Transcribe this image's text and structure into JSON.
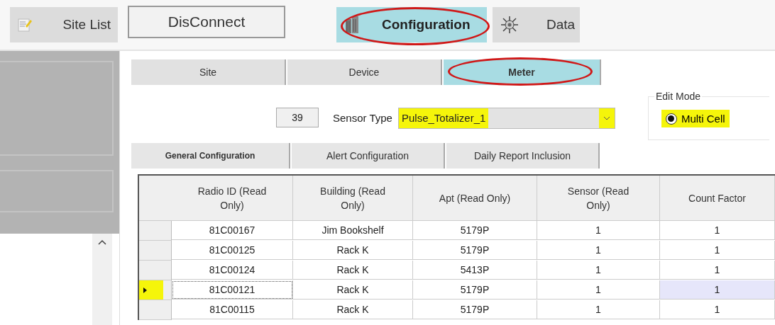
{
  "toolbar": [
    {
      "kind": "sitelist",
      "label": "Site List",
      "selected": false,
      "circled": false
    },
    {
      "kind": "plain",
      "label": "DisConnect",
      "selected": false,
      "circled": false
    },
    {
      "kind": "config",
      "label": "Configuration",
      "selected": true,
      "circled": true
    },
    {
      "kind": "data",
      "label": "Data",
      "selected": false,
      "circled": false
    }
  ],
  "tabs": [
    {
      "label": "Site",
      "selected": false,
      "circled": false
    },
    {
      "label": "Device",
      "selected": false,
      "circled": false
    },
    {
      "label": "Meter",
      "selected": true,
      "circled": true
    }
  ],
  "count": "39",
  "sensor_type": {
    "label": "Sensor Type",
    "value": "Pulse_Totalizer_1",
    "highlighted": true
  },
  "edit_mode": {
    "title": "Edit Mode",
    "option": "Multi Cell",
    "checked": true,
    "highlighted": true
  },
  "subtabs": [
    {
      "label": "General Configuration",
      "selected": true
    },
    {
      "label": "Alert Configuration",
      "selected": false
    },
    {
      "label": "Daily Report Inclusion",
      "selected": false
    }
  ],
  "table": {
    "columns": [
      "Radio ID (Read Only)",
      "Building (Read Only)",
      "Apt (Read Only)",
      "Sensor (Read Only)",
      "Count Factor"
    ],
    "rows": [
      {
        "current": false,
        "marked": false,
        "cells": [
          {
            "text": "81C00167",
            "selected": false
          },
          {
            "text": "Jim Bookshelf",
            "selected": false
          },
          {
            "text": "5179P",
            "selected": false
          },
          {
            "text": "1",
            "selected": false
          },
          {
            "text": "1",
            "selected": false
          }
        ]
      },
      {
        "current": false,
        "marked": false,
        "cells": [
          {
            "text": "81C00125",
            "selected": false
          },
          {
            "text": "Rack K",
            "selected": false
          },
          {
            "text": "5179P",
            "selected": false
          },
          {
            "text": "1",
            "selected": false
          },
          {
            "text": "1",
            "selected": false
          }
        ]
      },
      {
        "current": false,
        "marked": false,
        "cells": [
          {
            "text": "81C00124",
            "selected": false
          },
          {
            "text": "Rack K",
            "selected": false
          },
          {
            "text": "5413P",
            "selected": false
          },
          {
            "text": "1",
            "selected": false
          },
          {
            "text": "1",
            "selected": false
          }
        ]
      },
      {
        "current": true,
        "marked": true,
        "cells": [
          {
            "text": "81C00121",
            "selected": false
          },
          {
            "text": "Rack K",
            "selected": false
          },
          {
            "text": "5179P",
            "selected": false
          },
          {
            "text": "1",
            "selected": false
          },
          {
            "text": "1",
            "selected": true
          }
        ]
      },
      {
        "current": false,
        "marked": false,
        "cells": [
          {
            "text": "81C00115",
            "selected": false
          },
          {
            "text": "Rack K",
            "selected": false
          },
          {
            "text": "5179P",
            "selected": false
          },
          {
            "text": "1",
            "selected": false
          },
          {
            "text": "1",
            "selected": false
          }
        ]
      }
    ]
  }
}
